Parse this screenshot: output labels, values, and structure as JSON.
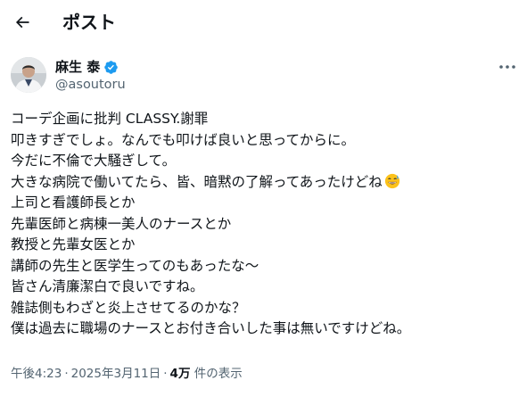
{
  "header": {
    "title": "ポスト",
    "back_icon": "arrow-left-icon"
  },
  "author": {
    "name": "麻生 泰",
    "handle": "@asoutoru",
    "verified": true,
    "verified_color": "#1d9bf0",
    "more_icon": "more-horizontal-icon"
  },
  "post": {
    "lines": [
      "コーデ企画に批判 CLASSY.謝罪",
      "叩きすぎでしょ。なんでも叩けば良いと思ってからに。",
      "今だに不倫で大騒ぎして。",
      "大きな病院で働いてたら、皆、暗黙の了解ってあったけどね",
      "上司と看護師長とか",
      "先輩医師と病棟一美人のナースとか",
      "教授と先輩女医とか",
      "講師の先生と医学生ってのもあったな～",
      "皆さん清廉潔白で良いですね。",
      "雑誌側もわざと炎上させてるのかな？",
      "僕は過去に職場のナースとお付き合いした事は無いですけどね。"
    ],
    "emoji_after_line_4": "grinning-face-with-sweat-icon"
  },
  "meta": {
    "time": "午後4:23",
    "separator": "·",
    "date": "2025年3月11日",
    "views_count": "4万",
    "views_label": "件の表示"
  },
  "colors": {
    "text": "#0f1419",
    "secondary": "#536471",
    "accent": "#1d9bf0"
  }
}
